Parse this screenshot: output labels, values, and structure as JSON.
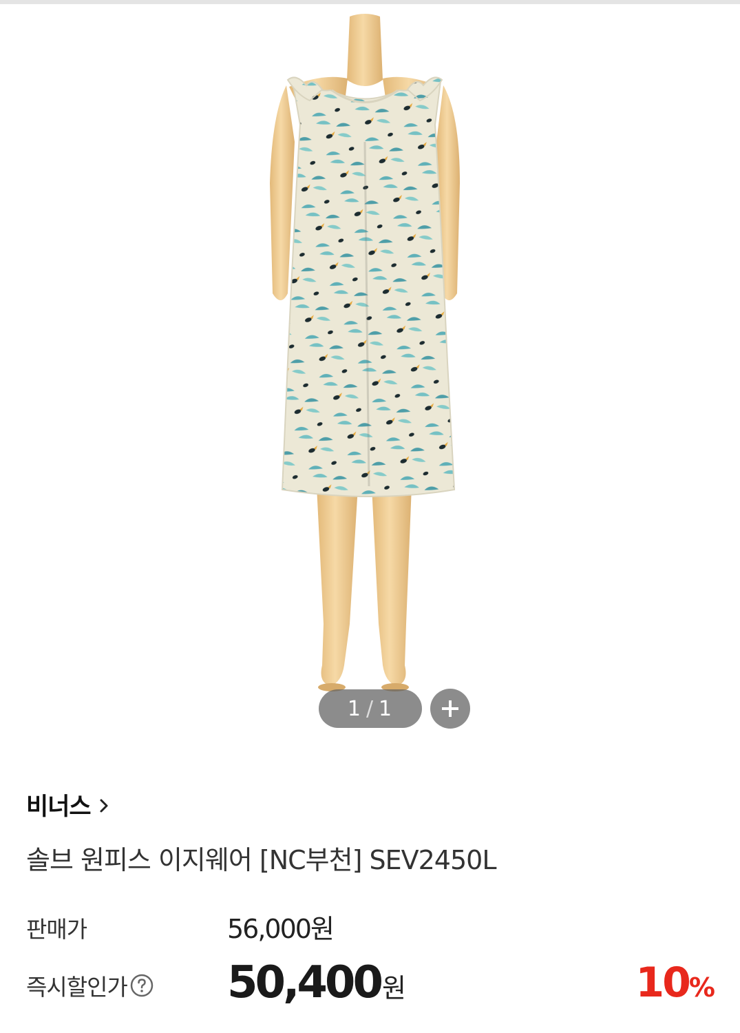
{
  "gallery": {
    "image_alt": "sleeveless tropical print dress on mannequin",
    "pager": {
      "current": "1",
      "separator": "/",
      "total": "1"
    },
    "zoom_icon": "plus-icon"
  },
  "product": {
    "brand": "비너스",
    "brand_chevron_icon": "chevron-right-icon",
    "title": "솔브 원피스 이지웨어 [NC부천] SEV2450L"
  },
  "pricing": {
    "regular_label": "판매가",
    "regular_price": "56,000원",
    "sale_label": "즉시할인가",
    "help_icon": "question-circle-icon",
    "sale_amount": "50,400",
    "sale_unit": "원",
    "discount_number": "10",
    "discount_suffix": "%"
  },
  "colors": {
    "discount_red": "#e8281c",
    "print_teal": "#5fb0b8",
    "dress_base": "#ece8d6",
    "mannequin_skin": "#f0cf95"
  }
}
